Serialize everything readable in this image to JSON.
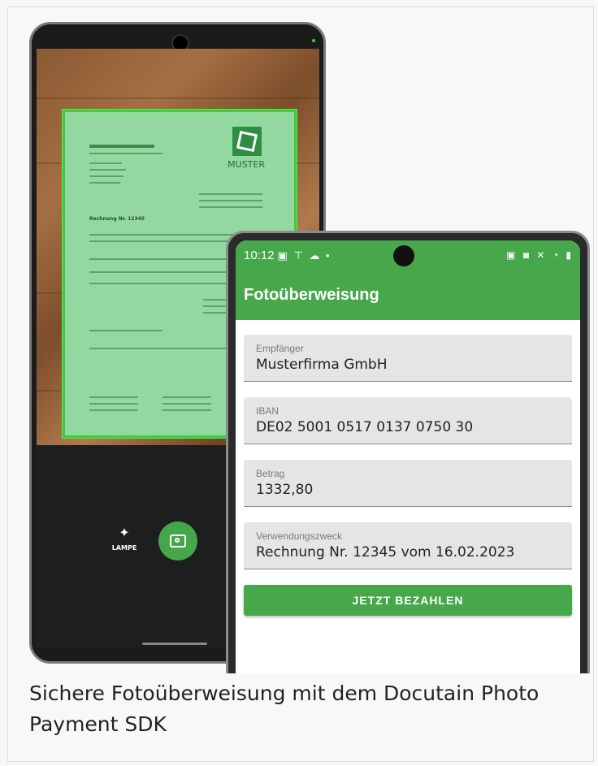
{
  "photo": {
    "scanner": {
      "document_logo_text": "MUSTER",
      "document_heading": "Rechnung Nr. 12345",
      "lamp_label": "LAMPE",
      "lamp_icon": "flashlight-icon",
      "shutter_icon": "camera-icon",
      "document_highlight_color": "#38d13a"
    },
    "app": {
      "status_time": "10:12",
      "status_left_icons": "▣ ⊤ ☁ •",
      "status_right_icons": "▣ ◙ ✕ ◔ ▮",
      "title": "Fotoüberweisung",
      "fields": [
        {
          "label": "Empfänger",
          "value": "Musterfirma GmbH"
        },
        {
          "label": "IBAN",
          "value": "DE02 5001 0517 0137 0750 30"
        },
        {
          "label": "Betrag",
          "value": "1332,80"
        },
        {
          "label": "Verwendungszweck",
          "value": "Rechnung Nr. 12345 vom 16.02.2023"
        }
      ],
      "pay_button": "JETZT BEZAHLEN",
      "accent_color": "#46a84b"
    }
  },
  "caption": "Sichere Fotoüberweisung mit dem Docutain Photo Payment SDK"
}
